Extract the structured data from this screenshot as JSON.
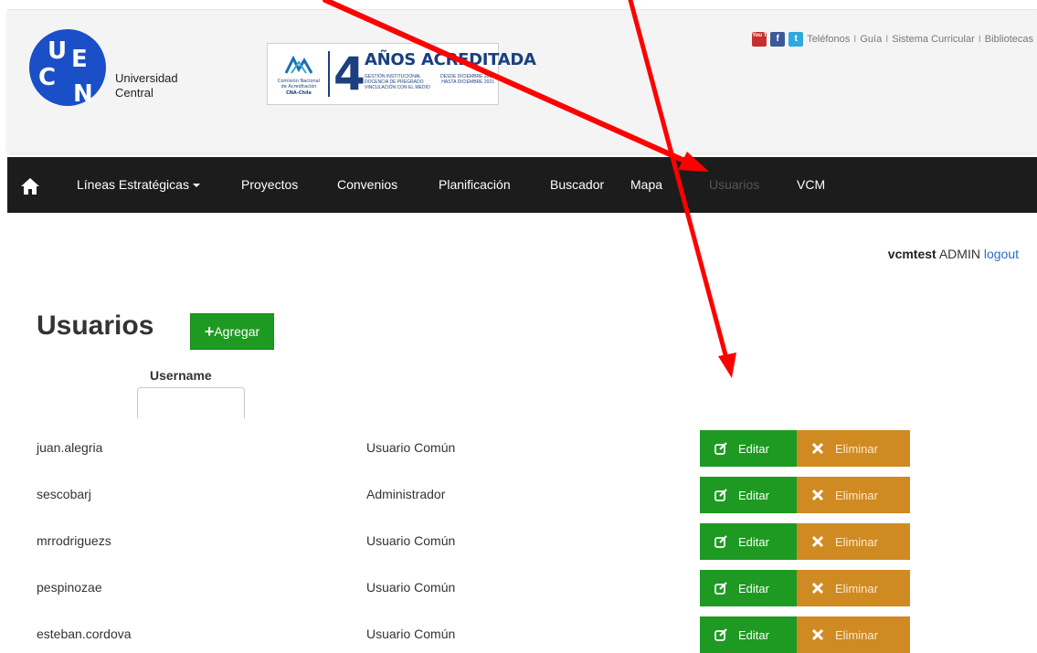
{
  "header": {
    "logo_letters": [
      "U",
      "C",
      "E",
      "N"
    ],
    "university_line1": "Universidad",
    "university_line2": "Central",
    "accreditation": {
      "number": "4",
      "title": "AÑOS ACREDITADA",
      "cna_line1": "Comisión Nacional",
      "cna_line2": "de Acreditación",
      "cna_line3": "CNA-Chile",
      "rows": [
        {
          "left": "GESTIÓN INSTITUCIONAL",
          "right": "DESDE DICIEMBRE 2017"
        },
        {
          "left": "DOCENCIA DE PREGRADO",
          "right": "HASTA DICIEMBRE 2021"
        },
        {
          "left": "VINCULACIÓN CON EL MEDIO",
          "right": ""
        }
      ]
    },
    "social": {
      "youtube_label": "You Tube",
      "facebook_label": "f",
      "twitter_label": "t"
    },
    "links": [
      "Teléfonos",
      "Guía",
      "Sistema Curricular",
      "Bibliotecas"
    ],
    "link_separator": "I"
  },
  "nav": {
    "items": [
      {
        "label": "Líneas Estratégicas",
        "dropdown": true
      },
      {
        "label": "Proyectos"
      },
      {
        "label": "Convenios"
      },
      {
        "label": "Planificación"
      },
      {
        "label": "Buscador"
      },
      {
        "label": "Mapa"
      },
      {
        "label": "Usuarios",
        "active": true
      },
      {
        "label": "VCM"
      }
    ]
  },
  "user": {
    "username": "vcmtest",
    "role": "ADMIN",
    "logout": "logout"
  },
  "page": {
    "title": "Usuarios",
    "add_label": "Agregar",
    "plus": "+"
  },
  "table": {
    "column_username": "Username",
    "filter_value": "",
    "edit_label": "Editar",
    "delete_label": "Eliminar",
    "rows": [
      {
        "username": "juan.alegria",
        "role": "Usuario Común"
      },
      {
        "username": "sescobarj",
        "role": "Administrador"
      },
      {
        "username": "mrrodriguezs",
        "role": "Usuario Común"
      },
      {
        "username": "pespinozae",
        "role": "Usuario Común"
      },
      {
        "username": "esteban.cordova",
        "role": "Usuario Común"
      }
    ]
  },
  "colors": {
    "navbar": "#1c1c1c",
    "success_green": "#1e9a22",
    "warning_orange": "#d08a22",
    "annotation_red": "#ff0000",
    "logo_blue": "#1a4fc7",
    "link_blue": "#2a6dc7"
  }
}
